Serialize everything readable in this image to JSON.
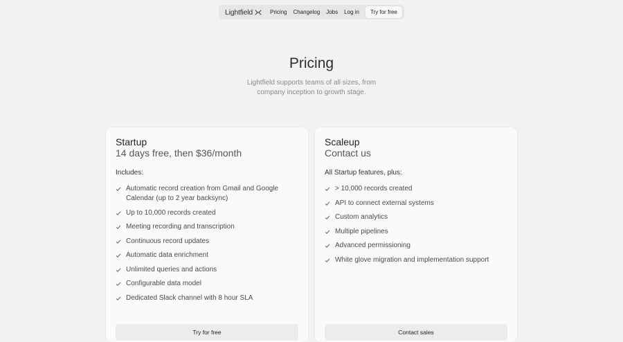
{
  "nav": {
    "logo_text": "Lightfield",
    "logo_icon": "asterisk-mark-icon",
    "links": [
      "Pricing",
      "Changelog",
      "Jobs",
      "Log in"
    ],
    "cta_label": "Try for free"
  },
  "hero": {
    "title": "Pricing",
    "subtitle": "Lightfield supports teams of all sizes, from company inception to growth stage."
  },
  "plans": [
    {
      "name": "Startup",
      "price": "14 days free, then $36/month",
      "intro": "Includes:",
      "features": [
        "Automatic record creation from Gmail and Google Calendar (up to 2 year backsync)",
        "Up to 10,000 records created",
        "Meeting recording and transcription",
        "Continuous record updates",
        "Automatic data enrichment",
        "Unlimited queries and actions",
        "Configurable data model",
        "Dedicated Slack channel with 8 hour SLA"
      ],
      "button_label": "Try for free"
    },
    {
      "name": "Scaleup",
      "price": "Contact us",
      "intro": "All Startup features, plus:",
      "features": [
        "> 10,000 records created",
        "API to connect external systems",
        "Custom analytics",
        "Multiple pipelines",
        "Advanced permissioning",
        "White glove migration and implementation support"
      ],
      "button_label": "Contact sales"
    }
  ],
  "colors": {
    "background": "#f2f2f2",
    "card": "#fafafa",
    "nav": "#e6e6e6",
    "button": "#ececec",
    "check": "#555555"
  }
}
